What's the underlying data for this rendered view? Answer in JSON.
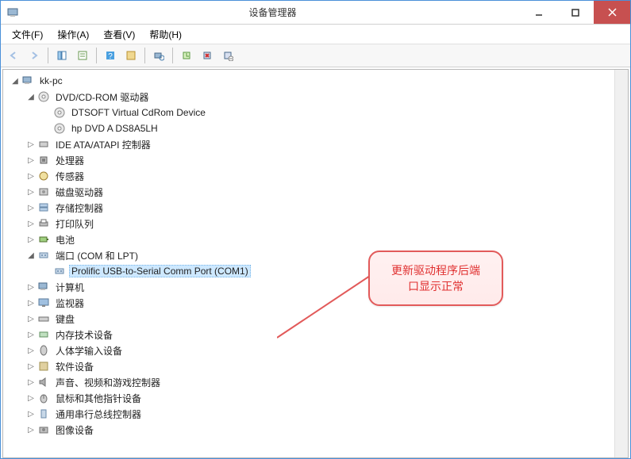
{
  "window": {
    "title": "设备管理器"
  },
  "menu": {
    "file": "文件(F)",
    "action": "操作(A)",
    "view": "查看(V)",
    "help": "帮助(H)"
  },
  "tree": {
    "root": "kk-pc",
    "dvd": {
      "label": "DVD/CD-ROM 驱动器",
      "child1": "DTSOFT Virtual CdRom Device",
      "child2": "hp DVD A  DS8A5LH"
    },
    "ide": "IDE ATA/ATAPI 控制器",
    "cpu": "处理器",
    "sensor": "传感器",
    "disk": "磁盘驱动器",
    "storage": "存储控制器",
    "printq": "打印队列",
    "battery": "电池",
    "ports": {
      "label": "端口 (COM 和 LPT)",
      "child1": "Prolific USB-to-Serial Comm Port (COM1)"
    },
    "computer": "计算机",
    "monitor": "监视器",
    "keyboard": "键盘",
    "memtech": "内存技术设备",
    "hid": "人体学输入设备",
    "software": "软件设备",
    "sound": "声音、视频和游戏控制器",
    "mouse": "鼠标和其他指针设备",
    "usbctrl": "通用串行总线控制器",
    "imaging": "图像设备"
  },
  "callout": {
    "line1": "更新驱动程序后端",
    "line2": "口显示正常"
  }
}
